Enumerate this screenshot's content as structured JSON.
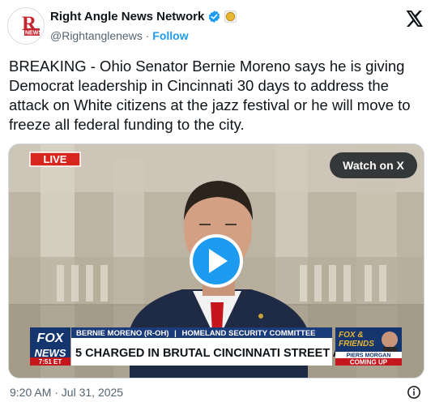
{
  "account": {
    "display_name": "Right Angle News Network",
    "handle": "@Rightanglenews",
    "separator": "·",
    "follow_label": "Follow",
    "avatar_text": "NEWS",
    "avatar_letter": "R"
  },
  "tweet": {
    "text": "BREAKING - Ohio Senator Bernie Moreno says he is giving Democrat leadership in Cincinnati 30 days to address the attack on White citizens at the jazz festival or he will move to freeze all federal funding to the city."
  },
  "video": {
    "live_label": "LIVE",
    "watch_label": "Watch on X",
    "lower_third_name": "BERNIE MORENO (R-OH)",
    "lower_third_divider": "|",
    "lower_third_role": "HOMELAND SECURITY COMMITTEE",
    "headline": "5 CHARGED IN BRUTAL CINCINNATI STREET ATTACK",
    "network_top": "FOX",
    "network_bottom": "NEWS",
    "time": "7:51 ET",
    "show_top": "FOX &",
    "show_bottom": "FRIENDS",
    "promo_name": "PIERS MORGAN",
    "promo_label": "COMING UP"
  },
  "footer": {
    "timestamp": "9:20 AM · Jul 31, 2025"
  },
  "icons": {
    "verified": "verified-badge-icon",
    "affiliate": "gold-affiliate-icon",
    "x_logo": "x-logo-icon",
    "play": "play-icon",
    "info": "info-icon"
  },
  "colors": {
    "follow": "#1d9bf0",
    "verified": "#1d9bf0",
    "live_red": "#d7261e",
    "fox_blue": "#14356e"
  }
}
